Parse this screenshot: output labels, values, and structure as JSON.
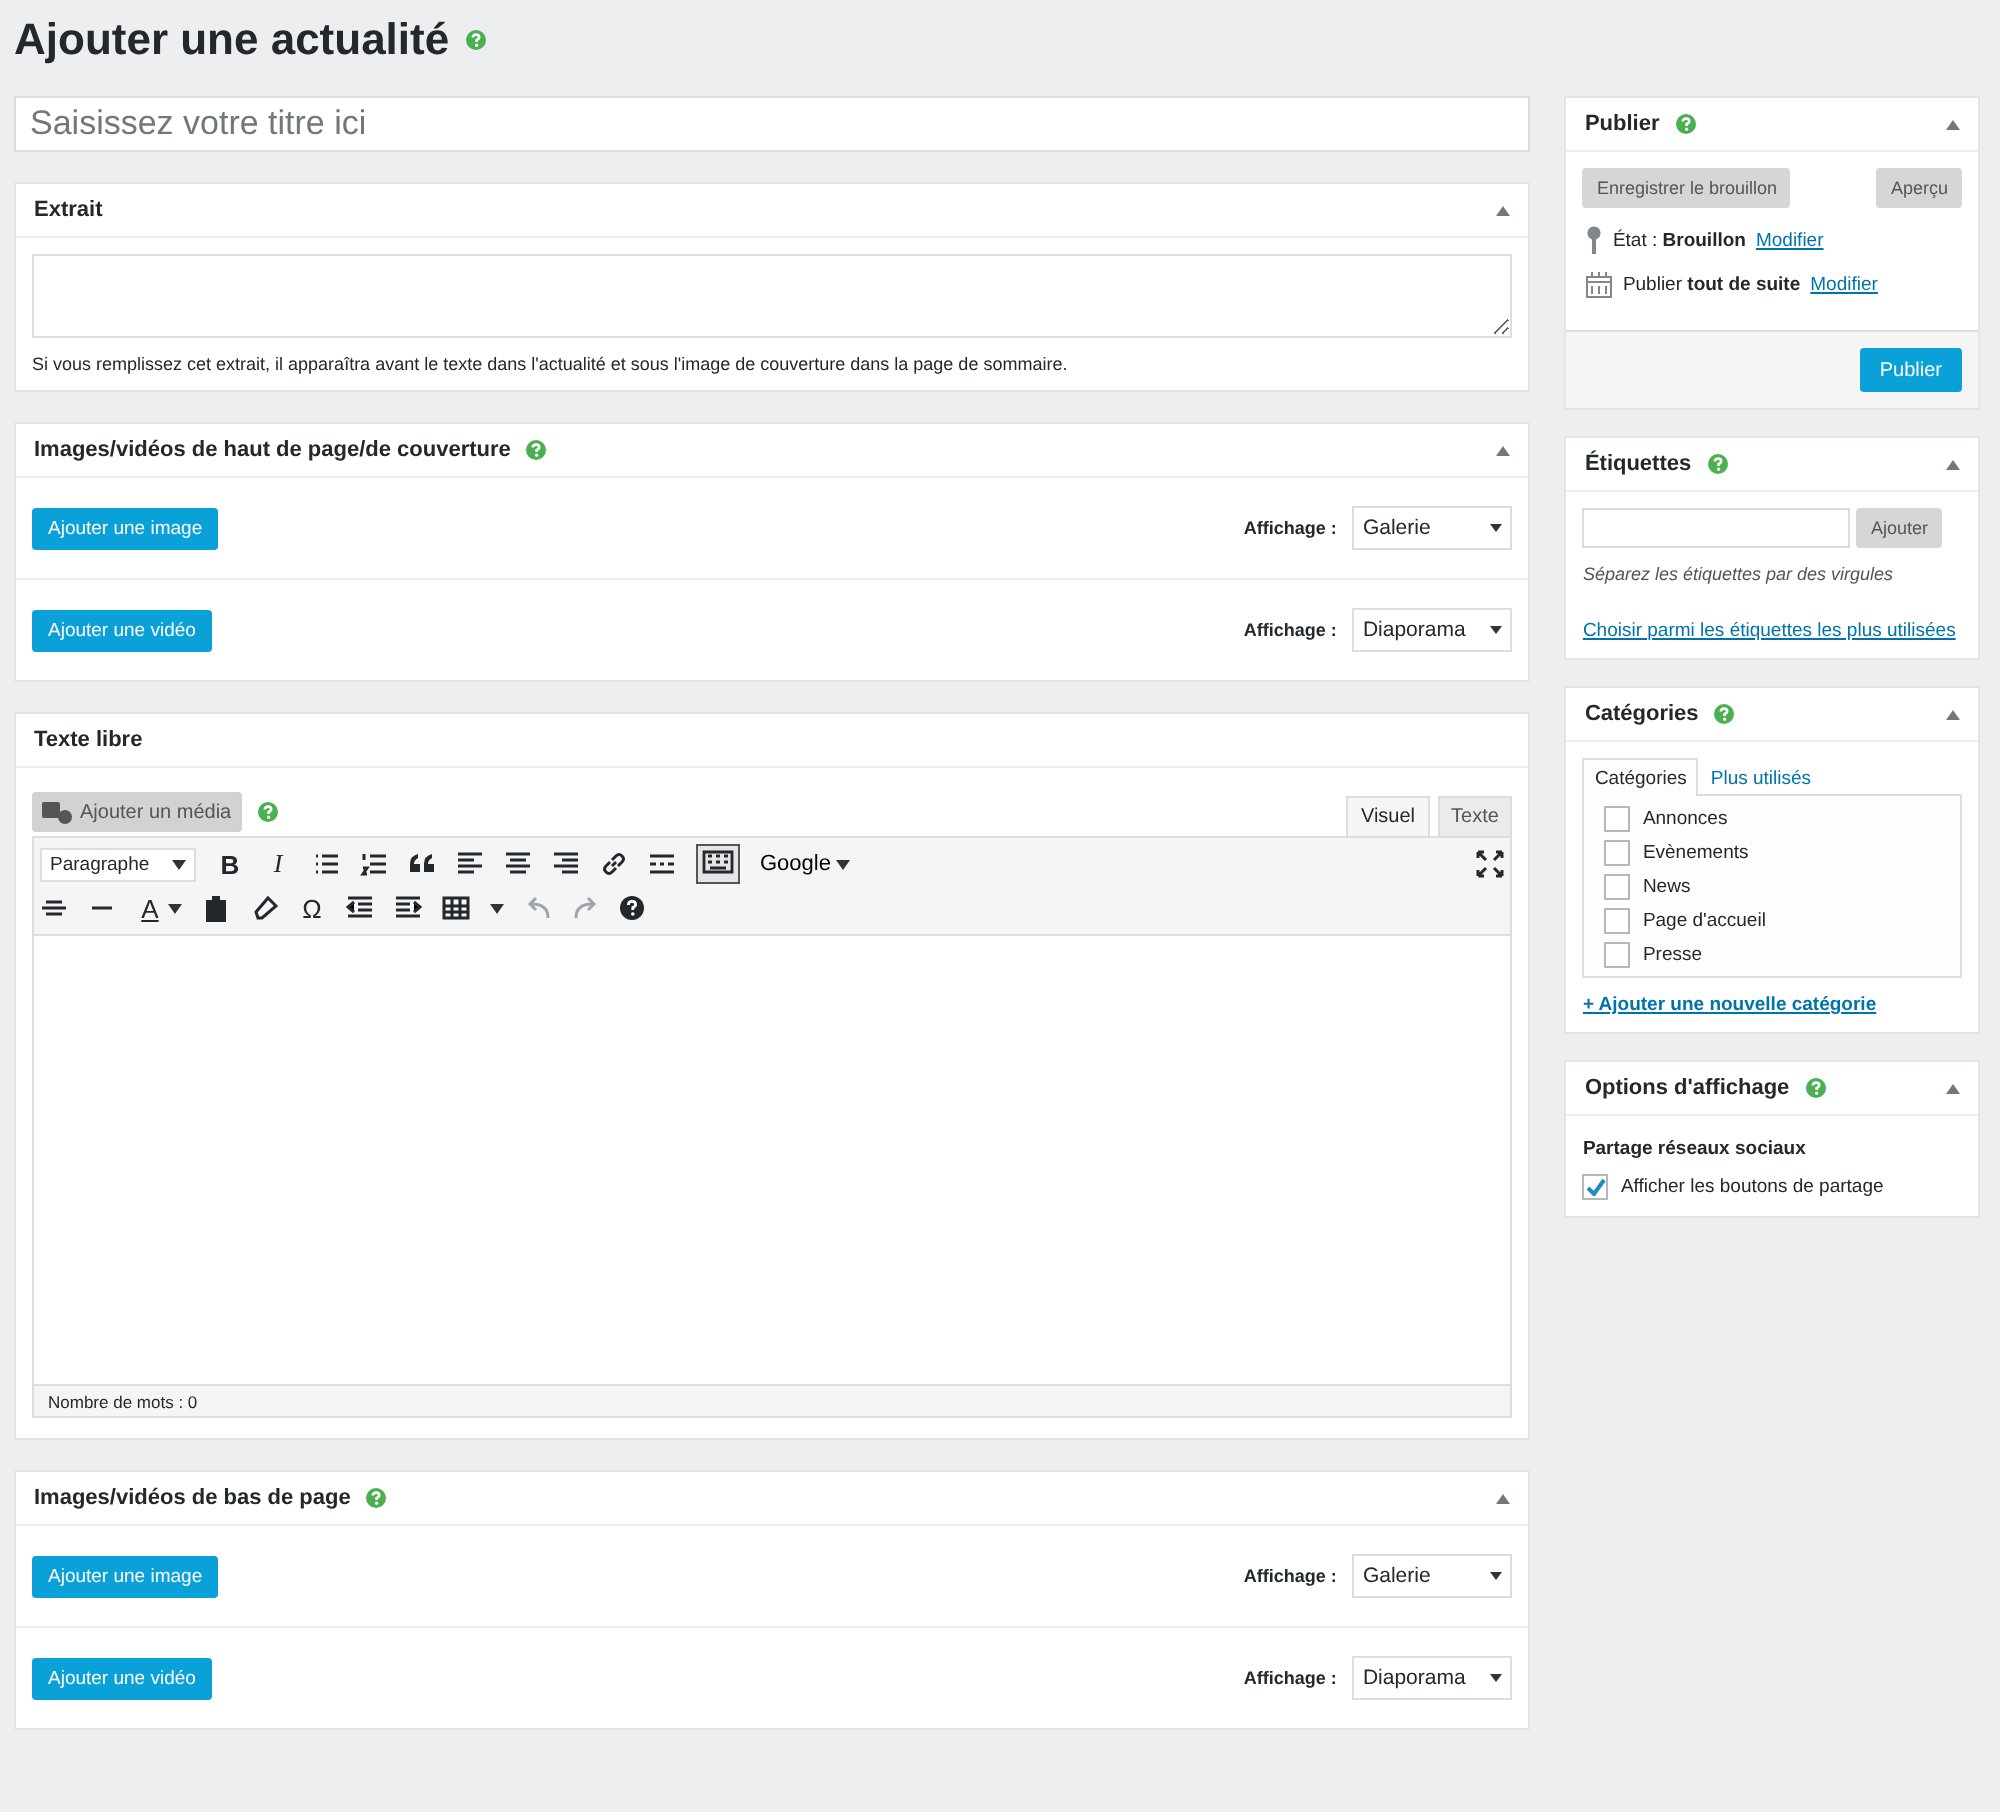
{
  "page_title": "Ajouter une actualité",
  "title_field": {
    "placeholder": "Saisissez votre titre ici"
  },
  "excerpt": {
    "title": "Extrait",
    "expanded": true,
    "hint": "Si vous remplissez cet extrait, il apparaîtra avant le texte dans l'actualité et sous l'image de couverture dans la page de sommaire."
  },
  "media_top": {
    "title": "Images/vidéos de haut de page/de couverture",
    "expanded": true,
    "rows": [
      {
        "button": "Ajouter une image",
        "label": "Affichage :",
        "value": "Galerie"
      },
      {
        "button": "Ajouter une vidéo",
        "label": "Affichage :",
        "value": "Diaporama"
      }
    ]
  },
  "editor": {
    "title": "Texte libre",
    "media_button": "Ajouter un média",
    "media_disabled": true,
    "tabs": [
      {
        "label": "Visuel",
        "selected": true
      },
      {
        "label": "Texte",
        "selected": false
      }
    ],
    "format": "Paragraphe",
    "bold": "B",
    "italic": "I",
    "font_menu": "Google",
    "text_color": "A",
    "special_char": "Ω",
    "kitchen_sink_on": true,
    "word_count": "Nombre de mots : 0"
  },
  "media_bottom": {
    "title": "Images/vidéos de bas de page",
    "expanded": true,
    "rows": [
      {
        "button": "Ajouter une image",
        "label": "Affichage :",
        "value": "Galerie"
      },
      {
        "button": "Ajouter une vidéo",
        "label": "Affichage :",
        "value": "Diaporama"
      }
    ]
  },
  "publish": {
    "title": "Publier",
    "expanded": true,
    "save_draft": "Enregistrer le brouillon",
    "save_disabled": true,
    "preview": "Aperçu",
    "preview_disabled": true,
    "status_label": "État : **Brouillon**",
    "status_link": "Modifier",
    "schedule_label": "Publier **tout de suite**",
    "schedule_link": "Modifier",
    "publish_button": "Publier"
  },
  "tags": {
    "title": "Étiquettes",
    "expanded": true,
    "add_button": "Ajouter",
    "add_disabled": true,
    "hint": "Séparez les étiquettes par des virgules",
    "choose_link": "Choisir parmi les étiquettes les plus utilisées"
  },
  "categories": {
    "title": "Catégories",
    "expanded": true,
    "tabs": [
      {
        "label": "Catégories",
        "selected": true
      },
      {
        "label": "Plus utilisés",
        "selected": false
      }
    ],
    "items": [
      {
        "label": "Annonces",
        "checked": false
      },
      {
        "label": "Evènements",
        "checked": false
      },
      {
        "label": "News",
        "checked": false
      },
      {
        "label": "Page d'accueil",
        "checked": false
      },
      {
        "label": "Presse",
        "checked": false
      }
    ],
    "add_link": "+ Ajouter une nouvelle catégorie"
  },
  "display_options": {
    "title": "Options d'affichage",
    "expanded": true,
    "group_label": "Partage réseaux sociaux",
    "items": [
      {
        "label": "Afficher les boutons de partage",
        "checked": true
      }
    ]
  }
}
